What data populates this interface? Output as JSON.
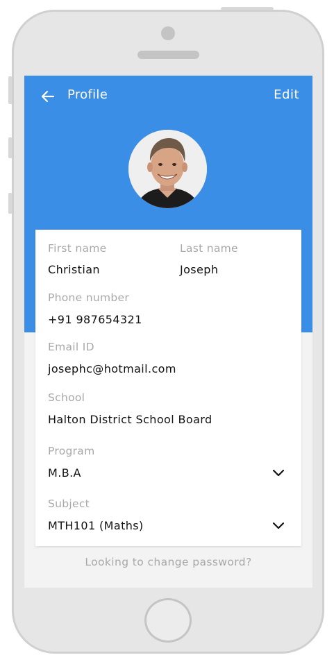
{
  "header": {
    "title": "Profile",
    "edit_label": "Edit",
    "accent_color": "#3b8ee6"
  },
  "avatar": {
    "icon": "user-photo"
  },
  "form": {
    "first_name": {
      "label": "First name",
      "value": "Christian"
    },
    "last_name": {
      "label": "Last name",
      "value": "Joseph"
    },
    "phone": {
      "label": "Phone number",
      "value": "+91 987654321"
    },
    "email": {
      "label": "Email ID",
      "value": "josephc@hotmail.com"
    },
    "school": {
      "label": "School",
      "value": "Halton District School Board"
    },
    "program": {
      "label": "Program",
      "value": "M.B.A"
    },
    "subject": {
      "label": "Subject",
      "value": "MTH101 (Maths)"
    }
  },
  "footer": {
    "change_password_label": "Looking to change password?"
  }
}
